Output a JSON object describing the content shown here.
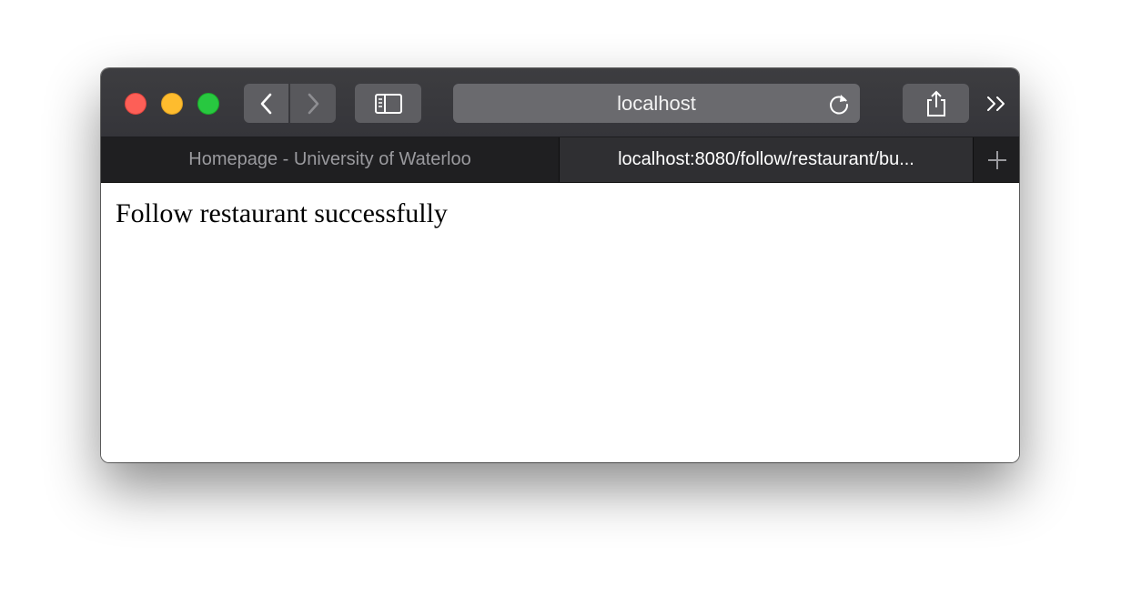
{
  "browser": {
    "address_text": "localhost",
    "tabs": [
      {
        "label": "Homepage - University of Waterloo",
        "active": false
      },
      {
        "label": "localhost:8080/follow/restaurant/bu...",
        "active": true
      }
    ],
    "icons": {
      "close": "close-icon",
      "minimize": "minimize-icon",
      "zoom": "zoom-icon",
      "back": "chevron-left-icon",
      "forward": "chevron-right-icon",
      "sidebar": "sidebar-icon",
      "reload": "reload-icon",
      "share": "share-icon",
      "more": "double-chevron-right-icon",
      "new_tab": "plus-icon"
    },
    "colors": {
      "close": "#fd5f57",
      "minimize": "#febc2e",
      "zoom": "#28c840"
    }
  },
  "page": {
    "message": "Follow restaurant successfully"
  }
}
